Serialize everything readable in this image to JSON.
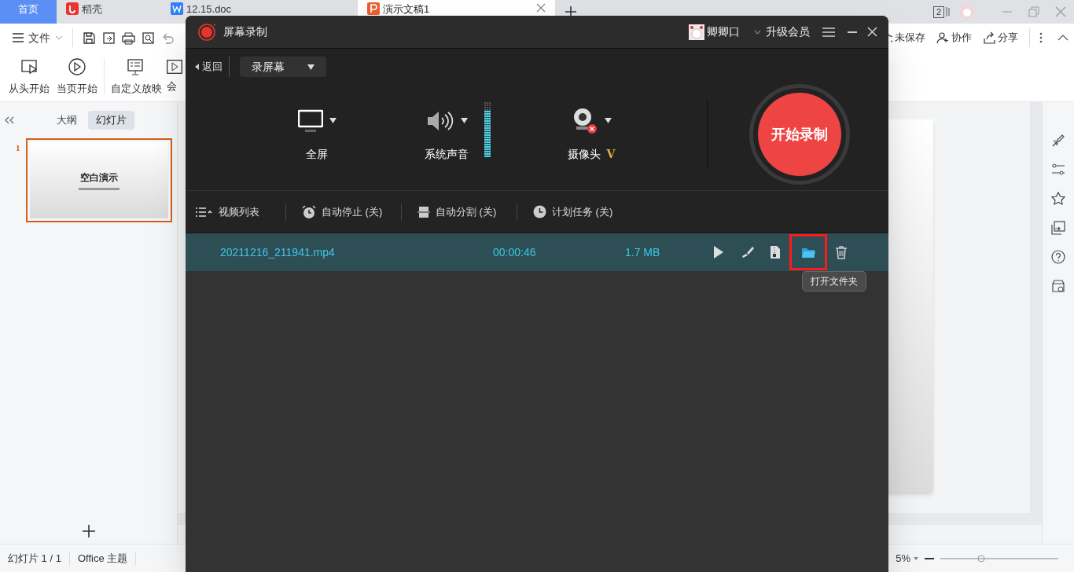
{
  "browser_tabs": [
    {
      "label": "首页",
      "kind": "home",
      "selected": false
    },
    {
      "label": "稻壳",
      "kind": "docer",
      "selected": false
    },
    {
      "label": "12.15.doc",
      "kind": "word",
      "selected": false
    },
    {
      "label": "演示文稿1",
      "kind": "ppt",
      "selected": true
    }
  ],
  "page_count": "2",
  "quick_toolbar": {
    "file_menu": "文件",
    "right_actions": [
      {
        "label": "未保存",
        "kind": "cloud"
      },
      {
        "label": "协作",
        "kind": "user"
      },
      {
        "label": "分享",
        "kind": "share"
      }
    ]
  },
  "ribbon": [
    {
      "label": "从头开始",
      "kind": "from-start"
    },
    {
      "label": "当页开始",
      "kind": "play"
    },
    {
      "label": "自定义放映",
      "kind": "custom"
    },
    {
      "label": "会",
      "kind": "meeting"
    }
  ],
  "slide_panel": {
    "tabs": [
      {
        "label": "大纲",
        "selected": false
      },
      {
        "label": "幻灯片",
        "selected": true
      }
    ],
    "slides": [
      {
        "number": "1",
        "title": "空白演示",
        "selected": true
      }
    ]
  },
  "status_bar": {
    "slide": "幻灯片 1 / 1",
    "theme": "Office 主题",
    "zoom": "5%"
  },
  "recorder": {
    "title": "屏幕录制",
    "user": "卿卿口",
    "upgrade": "升级会员",
    "back": "返回",
    "mode": "录屏幕",
    "sources": [
      {
        "kind": "screen",
        "label": "全屏"
      },
      {
        "kind": "audio",
        "label": "系统声音",
        "level": 0.85
      },
      {
        "kind": "camera",
        "label": "摄像头",
        "badge": "V",
        "disabled": true
      }
    ],
    "record_button": "开始录制",
    "options": [
      {
        "kind": "list",
        "label": "视频列表"
      },
      {
        "kind": "alarm",
        "label": "自动停止 (关)"
      },
      {
        "kind": "split",
        "label": "自动分割 (关)"
      },
      {
        "kind": "clock",
        "label": "计划任务 (关)"
      }
    ],
    "files": [
      {
        "name": "20211216_211941.mp4",
        "duration": "00:00:46",
        "size": "1.7 MB",
        "selected": true
      }
    ],
    "actions": [
      {
        "kind": "play",
        "highlighted": false
      },
      {
        "kind": "edit",
        "highlighted": false
      },
      {
        "kind": "compress",
        "highlighted": false
      },
      {
        "kind": "folder",
        "highlighted": true
      },
      {
        "kind": "delete",
        "highlighted": false
      }
    ],
    "tooltip": "打开文件夹"
  }
}
